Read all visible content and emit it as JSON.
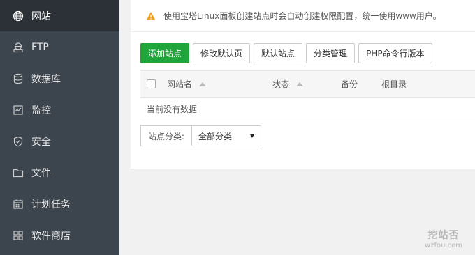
{
  "sidebar": {
    "items": [
      {
        "label": "网站",
        "icon": "globe-icon"
      },
      {
        "label": "FTP",
        "icon": "ftp-icon"
      },
      {
        "label": "数据库",
        "icon": "database-icon"
      },
      {
        "label": "监控",
        "icon": "monitor-icon"
      },
      {
        "label": "安全",
        "icon": "shield-icon"
      },
      {
        "label": "文件",
        "icon": "folder-icon"
      },
      {
        "label": "计划任务",
        "icon": "calendar-icon"
      },
      {
        "label": "软件商店",
        "icon": "apps-icon"
      }
    ]
  },
  "notice": {
    "text": "使用宝塔Linux面板创建站点时会自动创建权限配置，统一使用www用户。",
    "icon": "warning-icon",
    "icon_color": "#f0a020"
  },
  "toolbar": {
    "add_site": "添加站点",
    "edit_default_page": "修改默认页",
    "default_site": "默认站点",
    "category_manage": "分类管理",
    "php_cli_version": "PHP命令行版本"
  },
  "table": {
    "headers": {
      "site_name": "网站名",
      "status": "状态",
      "backup": "备份",
      "root_dir": "根目录"
    },
    "empty_text": "当前没有数据"
  },
  "category": {
    "label": "站点分类:",
    "selected": "全部分类"
  },
  "colors": {
    "sidebar_bg": "#3c444d",
    "sidebar_active_bg": "#2c3138",
    "primary": "#20a53a"
  },
  "watermark": {
    "title": "挖站否",
    "subtitle": "wzfou.com"
  }
}
